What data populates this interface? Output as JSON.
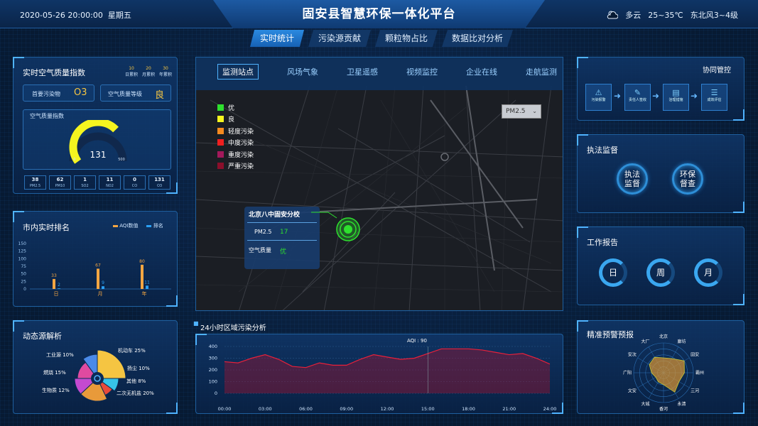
{
  "header": {
    "datetime": "2020-05-26 20:00:00",
    "weekday": "星期五",
    "title": "固安县智慧环保一体化平台",
    "weather": "多云",
    "temp": "25~35℃",
    "wind": "东北风3~4级"
  },
  "tabs": [
    "实时统计",
    "污染源贡献",
    "颗粒物占比",
    "数据比对分析"
  ],
  "aqi_panel": {
    "title": "实时空气质量指数",
    "periods": [
      {
        "num": "10",
        "label": "日累积"
      },
      {
        "num": "20",
        "label": "月累积"
      },
      {
        "num": "30",
        "label": "年累积"
      }
    ],
    "primary_label": "首要污染物",
    "primary_value": "O3",
    "level_label": "空气质量等级",
    "level_value": "良",
    "gauge_title": "空气质量指数",
    "gauge_value": "131",
    "gauge_min": "0",
    "gauge_max": "500",
    "gauge_fraction": 0.262,
    "pollutants": [
      {
        "v": "38",
        "n": "PM2.5"
      },
      {
        "v": "62",
        "n": "PM10"
      },
      {
        "v": "1",
        "n": "SO2"
      },
      {
        "v": "11",
        "n": "NO2"
      },
      {
        "v": "0",
        "n": "CO"
      },
      {
        "v": "131",
        "n": "O3"
      }
    ]
  },
  "ranking": {
    "title": "市内实时排名",
    "legend_aqi": "AQI数值",
    "legend_rank": "排名",
    "chart_data": {
      "type": "bar",
      "categories": [
        "日",
        "月",
        "年"
      ],
      "series": [
        {
          "name": "AQI数值",
          "values": [
            33,
            67,
            80
          ]
        },
        {
          "name": "排名",
          "values": [
            2,
            9,
            11
          ]
        }
      ],
      "ylim": [
        0,
        150
      ],
      "yticks": [
        "0",
        "25",
        "50",
        "75",
        "100",
        "125",
        "150"
      ]
    }
  },
  "source": {
    "title": "动态源解析",
    "items": [
      {
        "label": "工业源 10%"
      },
      {
        "label": "燃烧 15%"
      },
      {
        "label": "生物质 12%"
      },
      {
        "label": "机动车 25%"
      },
      {
        "label": "扬尘 10%"
      },
      {
        "label": "其他 8%"
      },
      {
        "label": "二次无机盐 20%"
      }
    ],
    "chart_data": {
      "type": "pie",
      "slices": [
        {
          "name": "机动车",
          "value": 25
        },
        {
          "name": "扬尘",
          "value": 10
        },
        {
          "name": "其他",
          "value": 8
        },
        {
          "name": "二次无机盐",
          "value": 20
        },
        {
          "name": "生物质",
          "value": 12
        },
        {
          "name": "燃烧",
          "value": 15
        },
        {
          "name": "工业源",
          "value": 10
        }
      ]
    }
  },
  "map": {
    "tabs": [
      "监测站点",
      "风场气象",
      "卫星遥感",
      "视频监控",
      "企业在线",
      "走航监测"
    ],
    "select": "PM2.5",
    "legend": [
      {
        "label": "优",
        "color": "#2ee02e"
      },
      {
        "label": "良",
        "color": "#f5f51f"
      },
      {
        "label": "轻度污染",
        "color": "#f58a1f"
      },
      {
        "label": "中度污染",
        "color": "#f01f1f"
      },
      {
        "label": "重度污染",
        "color": "#a3195b"
      },
      {
        "label": "严重污染",
        "color": "#8a0f2b"
      }
    ],
    "station": "北京八中固安分校",
    "pm_label": "PM2.5",
    "pm_value": "17",
    "aq_label": "空气质量",
    "aq_value": "优"
  },
  "trend": {
    "title": "24小时区域污染分析",
    "tooltip": "AQI : 90",
    "chart_data": {
      "type": "area",
      "x": [
        "00:00",
        "03:00",
        "06:00",
        "09:00",
        "12:00",
        "15:00",
        "18:00",
        "21:00",
        "24:00"
      ],
      "ylim": [
        0,
        400
      ],
      "yticks": [
        "0",
        "100",
        "200",
        "300",
        "400"
      ],
      "points": [
        [
          0,
          270
        ],
        [
          1,
          260
        ],
        [
          2,
          300
        ],
        [
          3,
          330
        ],
        [
          4,
          290
        ],
        [
          5,
          230
        ],
        [
          6,
          220
        ],
        [
          7,
          260
        ],
        [
          8,
          240
        ],
        [
          9,
          240
        ],
        [
          10,
          290
        ],
        [
          11,
          330
        ],
        [
          12,
          310
        ],
        [
          13,
          290
        ],
        [
          14,
          300
        ],
        [
          15,
          340
        ],
        [
          16,
          380
        ],
        [
          17,
          380
        ],
        [
          18,
          380
        ],
        [
          19,
          370
        ],
        [
          20,
          350
        ],
        [
          21,
          330
        ],
        [
          22,
          340
        ],
        [
          23,
          300
        ],
        [
          24,
          250
        ]
      ]
    }
  },
  "coop": {
    "title": "协同管控",
    "steps": [
      {
        "label": "污染报警",
        "icon": "alarm-icon"
      },
      {
        "label": "责任人签收",
        "icon": "sign-icon"
      },
      {
        "label": "治理措施",
        "icon": "document-icon"
      },
      {
        "label": "成效评估",
        "icon": "report-icon"
      }
    ]
  },
  "enforce": {
    "title": "执法监督",
    "btn1": "执法监督",
    "btn2": "环保督查"
  },
  "report": {
    "title": "工作报告",
    "day": "日",
    "week": "周",
    "month": "月"
  },
  "warning": {
    "title": "精准预警预报",
    "labels": [
      "北京",
      "廊坊",
      "固安",
      "霸州",
      "三河",
      "永清",
      "香河",
      "大城",
      "文安",
      "广阳",
      "安次",
      "大厂"
    ],
    "chart_data": {
      "type": "radar",
      "series": [
        {
          "values": [
            0.5,
            0.55,
            0.8,
            0.7,
            0.6,
            0.75,
            0.4,
            0.35,
            0.3,
            0.4,
            0.55,
            0.6
          ]
        }
      ]
    }
  }
}
